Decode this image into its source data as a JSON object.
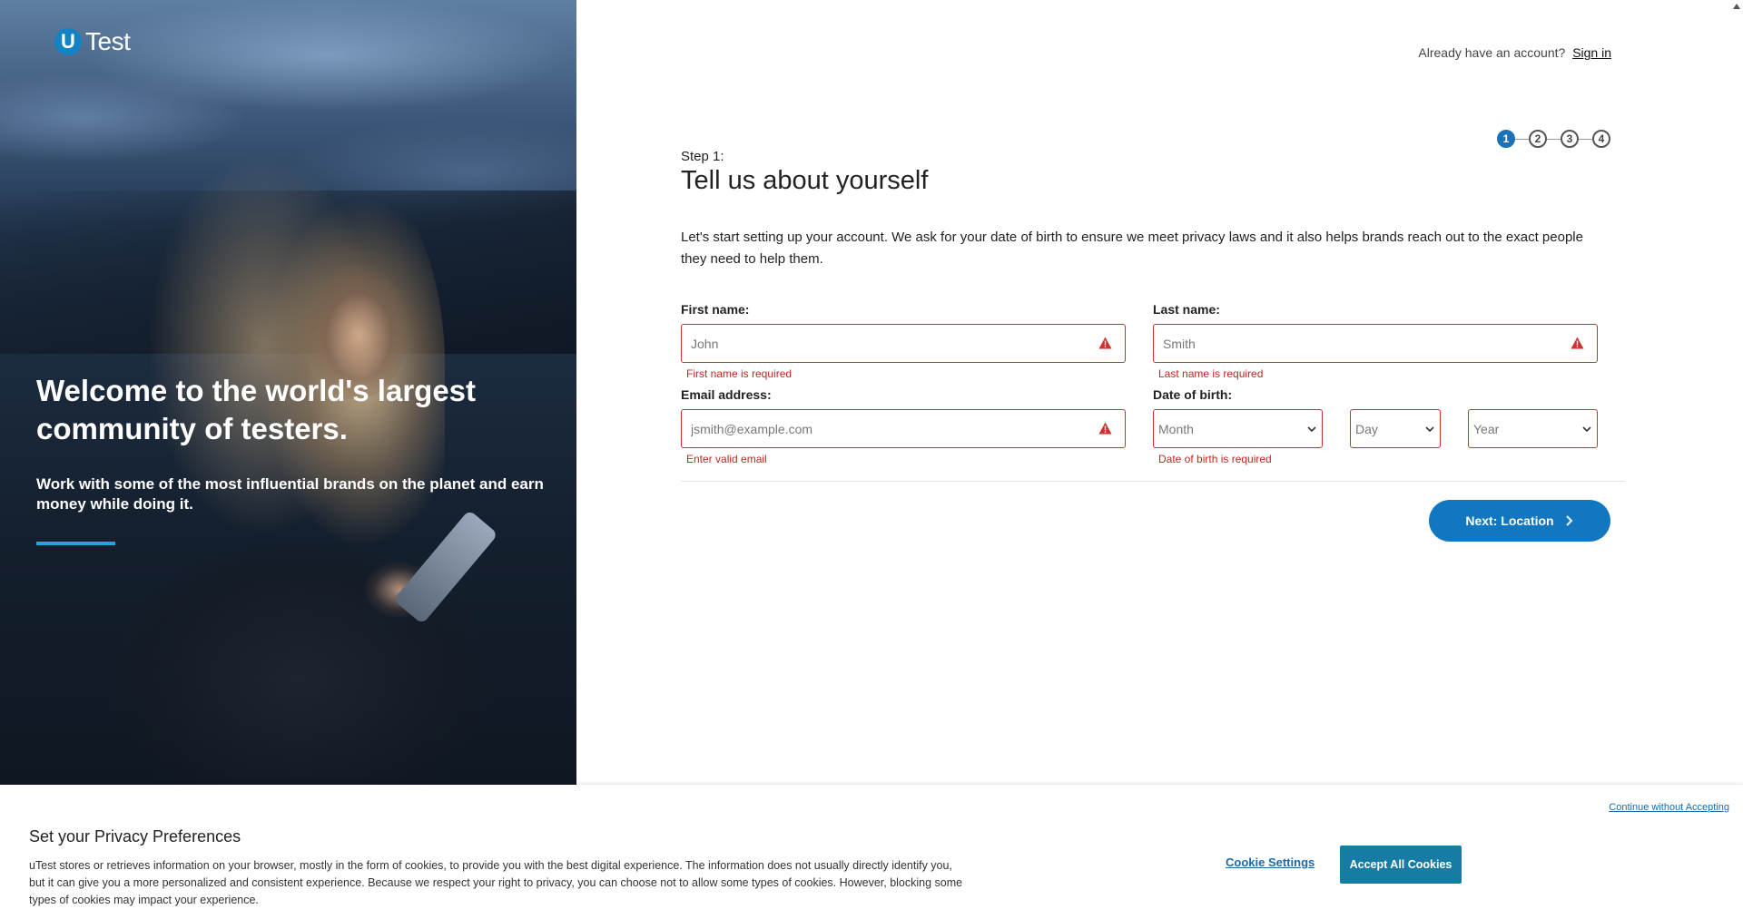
{
  "logo": {
    "letter": "U",
    "text": "Test"
  },
  "hero": {
    "title": "Welcome to the world's largest community of testers.",
    "subtitle": "Work with some of the most influential brands on the planet and earn money while doing it.",
    "accent_color": "#23a6d5"
  },
  "account": {
    "prompt": "Already have an account?",
    "sign_in": "Sign in"
  },
  "steps": {
    "items": [
      "1",
      "2",
      "3",
      "4"
    ],
    "active": "1"
  },
  "form": {
    "step_label": "Step 1:",
    "title": "Tell us about yourself",
    "intro": "Let's start setting up your account. We ask for your date of birth to ensure we meet privacy laws and it also helps brands reach out to the exact people they need to help them.",
    "first_name": {
      "label": "First name:",
      "placeholder": "John",
      "value": "",
      "error": "First name is required"
    },
    "last_name": {
      "label": "Last name:",
      "placeholder": "Smith",
      "value": "",
      "error": "Last name is required"
    },
    "email": {
      "label": "Email address:",
      "placeholder": "jsmith@example.com",
      "value": "",
      "error": "Enter valid email"
    },
    "dob": {
      "label": "Date of birth:",
      "month": "Month",
      "day": "Day",
      "year": "Year",
      "error": "Date of birth is required"
    },
    "next_button": "Next: Location",
    "error_color": "#c0271f",
    "primary_color": "#1277c1"
  },
  "cookie": {
    "title": "Set your Privacy Preferences",
    "text": "uTest stores or retrieves information on your browser, mostly in the form of cookies, to provide you with the best digital experience. The information does not usually directly identify you, but it can give you a more personalized and consistent experience. Because we respect your right to privacy, you can choose not to allow some types of cookies. However, blocking some types of cookies may impact your experience.",
    "continue": "Continue without Accepting",
    "settings": "Cookie Settings",
    "accept": "Accept All Cookies"
  },
  "icons": {
    "warning": "warning-triangle-icon",
    "chevron": "chevron-down-icon",
    "next": "chevron-right-icon"
  }
}
